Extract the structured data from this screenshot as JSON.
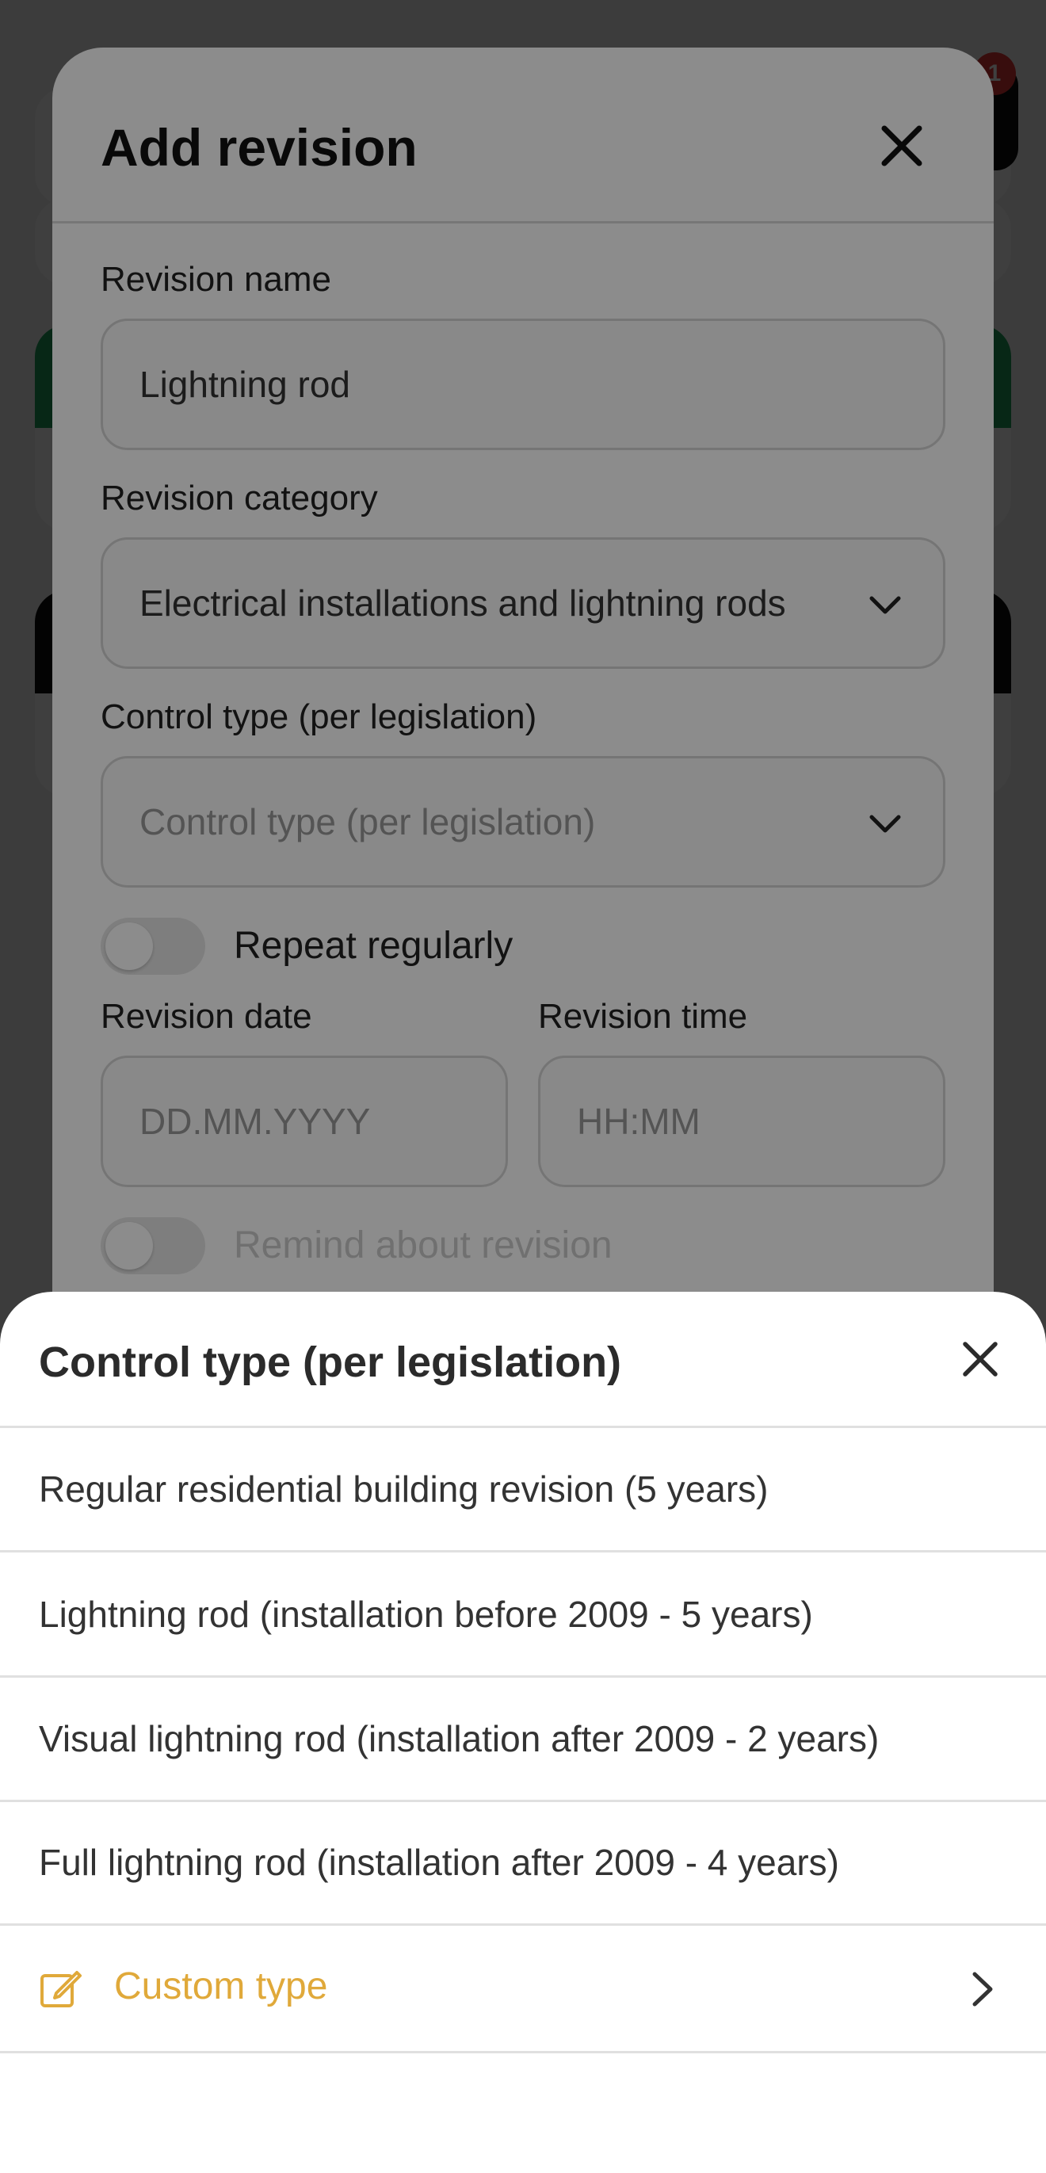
{
  "background": {
    "badge_count": "1"
  },
  "modal": {
    "title": "Add revision",
    "fields": {
      "revision_name_label": "Revision name",
      "revision_name_value": "Lightning rod",
      "revision_category_label": "Revision category",
      "revision_category_value": "Electrical installations and lightning rods",
      "control_type_label": "Control type (per legislation)",
      "control_type_placeholder": "Control type (per legislation)",
      "repeat_label": "Repeat regularly",
      "revision_date_label": "Revision date",
      "revision_date_placeholder": "DD.MM.YYYY",
      "revision_time_label": "Revision time",
      "revision_time_placeholder": "HH:MM",
      "remind_label": "Remind about revision"
    }
  },
  "sheet": {
    "title": "Control type (per legislation)",
    "options": [
      "Regular residential building revision (5 years)",
      "Lightning rod (installation before 2009 - 5 years)",
      "Visual lightning rod (installation after 2009 - 2 years)",
      "Full lightning rod (installation after 2009 - 4 years)"
    ],
    "custom_label": "Custom type",
    "accent_color": "#E0A93A"
  }
}
